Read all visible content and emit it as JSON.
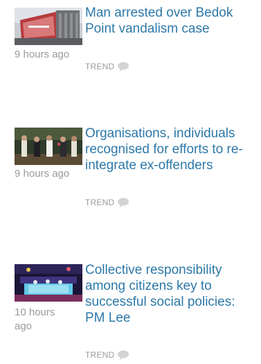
{
  "articles": [
    {
      "headline": "Man arrested over Bedok Point vandalism case",
      "timestamp": "9 hours ago",
      "category": "TREND",
      "thumbnail_icon": "bedok-point-building-photo"
    },
    {
      "headline": "Organisations, individuals recognised for efforts to re-integrate ex-offenders",
      "timestamp": "9 hours ago",
      "category": "TREND",
      "thumbnail_icon": "award-ceremony-photo"
    },
    {
      "headline": "Collective responsibility among citizens key to successful social policies: PM Lee",
      "timestamp": "10 hours ago",
      "category": "TREND",
      "thumbnail_icon": "stage-event-photo"
    }
  ],
  "icons": {
    "comment": "comment-bubble-icon"
  }
}
